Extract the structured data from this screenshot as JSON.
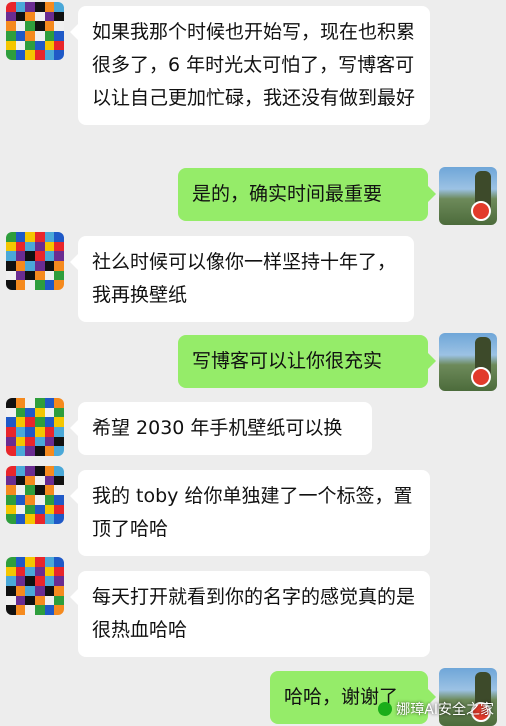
{
  "messages": [
    {
      "side": "left",
      "text": "如果我那个时候也开始写，现在也积累很多了，6 年时光太可怕了，写博客可以让自己更加忙碌，我还没有做到最好"
    },
    {
      "side": "right",
      "text": "是的，确实时间最重要"
    },
    {
      "side": "left",
      "text": "社么时候可以像你一样坚持十年了，我再换壁纸"
    },
    {
      "side": "right",
      "text": "写博客可以让你很充实"
    },
    {
      "side": "left",
      "text": "希望 2030 年手机壁纸可以换"
    },
    {
      "side": "left",
      "text": "我的 toby 给你单独建了一个标签，置顶了哈哈"
    },
    {
      "side": "left",
      "text": "每天打开就看到你的名字的感觉真的是很热血哈哈"
    },
    {
      "side": "right",
      "text": "哈哈，谢谢了"
    }
  ],
  "avatars": {
    "left_icon": "rubik-mosaic-avatar",
    "right_icon": "landscape-photo-avatar",
    "mosaic_colors": [
      "#e8262b",
      "#f4c600",
      "#1f59c7",
      "#2e9e3c",
      "#f0f0f0",
      "#f58a1e",
      "#111111",
      "#6a2c91",
      "#4aa8d8"
    ]
  },
  "colors": {
    "background": "#ededed",
    "incoming_bubble": "#ffffff",
    "outgoing_bubble": "#95ec69"
  },
  "watermark": {
    "text": "娜璋AI安全之家"
  }
}
